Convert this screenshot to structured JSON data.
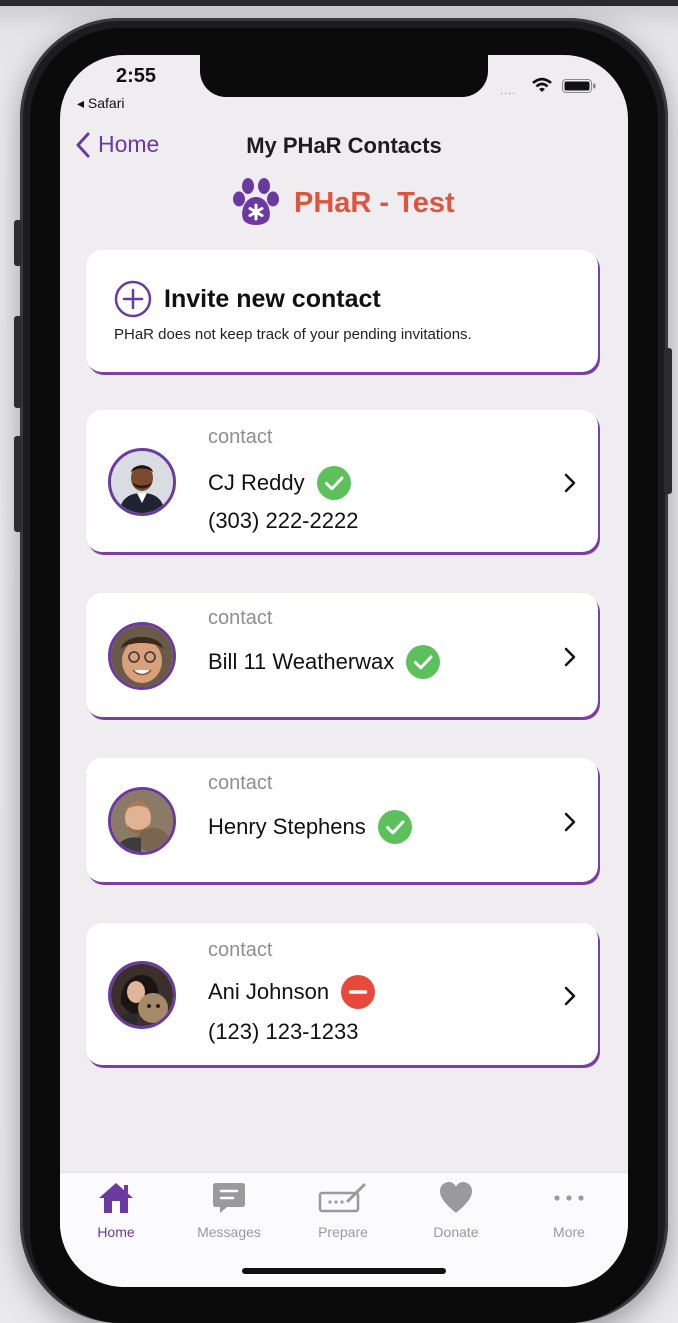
{
  "status_bar": {
    "time": "2:55",
    "back_app": "◂ Safari",
    "signal": "...."
  },
  "nav": {
    "back_label": "Home",
    "title": "My PHaR Contacts"
  },
  "brand": {
    "name": "PHaR - Test",
    "icon": "paw-icon",
    "color": "#e0533f"
  },
  "invite": {
    "title": "Invite new contact",
    "note": "PHaR does not keep track of your pending invitations."
  },
  "contacts": [
    {
      "label": "contact",
      "name": "CJ Reddy",
      "phone": "(303) 222-2222",
      "status": "verified"
    },
    {
      "label": "contact",
      "name": "Bill 11 Weatherwax",
      "phone": "",
      "status": "verified"
    },
    {
      "label": "contact",
      "name": "Henry Stephens",
      "phone": "",
      "status": "verified"
    },
    {
      "label": "contact",
      "name": "Ani Johnson",
      "phone": "(123) 123-1233",
      "status": "blocked"
    }
  ],
  "tabs": [
    {
      "label": "Home",
      "icon": "home-icon",
      "active": true
    },
    {
      "label": "Messages",
      "icon": "message-icon",
      "active": false
    },
    {
      "label": "Prepare",
      "icon": "prepare-icon",
      "active": false
    },
    {
      "label": "Donate",
      "icon": "heart-icon",
      "active": false
    },
    {
      "label": "More",
      "icon": "more-icon",
      "active": false
    }
  ],
  "colors": {
    "accent": "#6b3aa0",
    "brand": "#e0533f",
    "verified": "#5cc15a",
    "blocked": "#e8493b"
  }
}
